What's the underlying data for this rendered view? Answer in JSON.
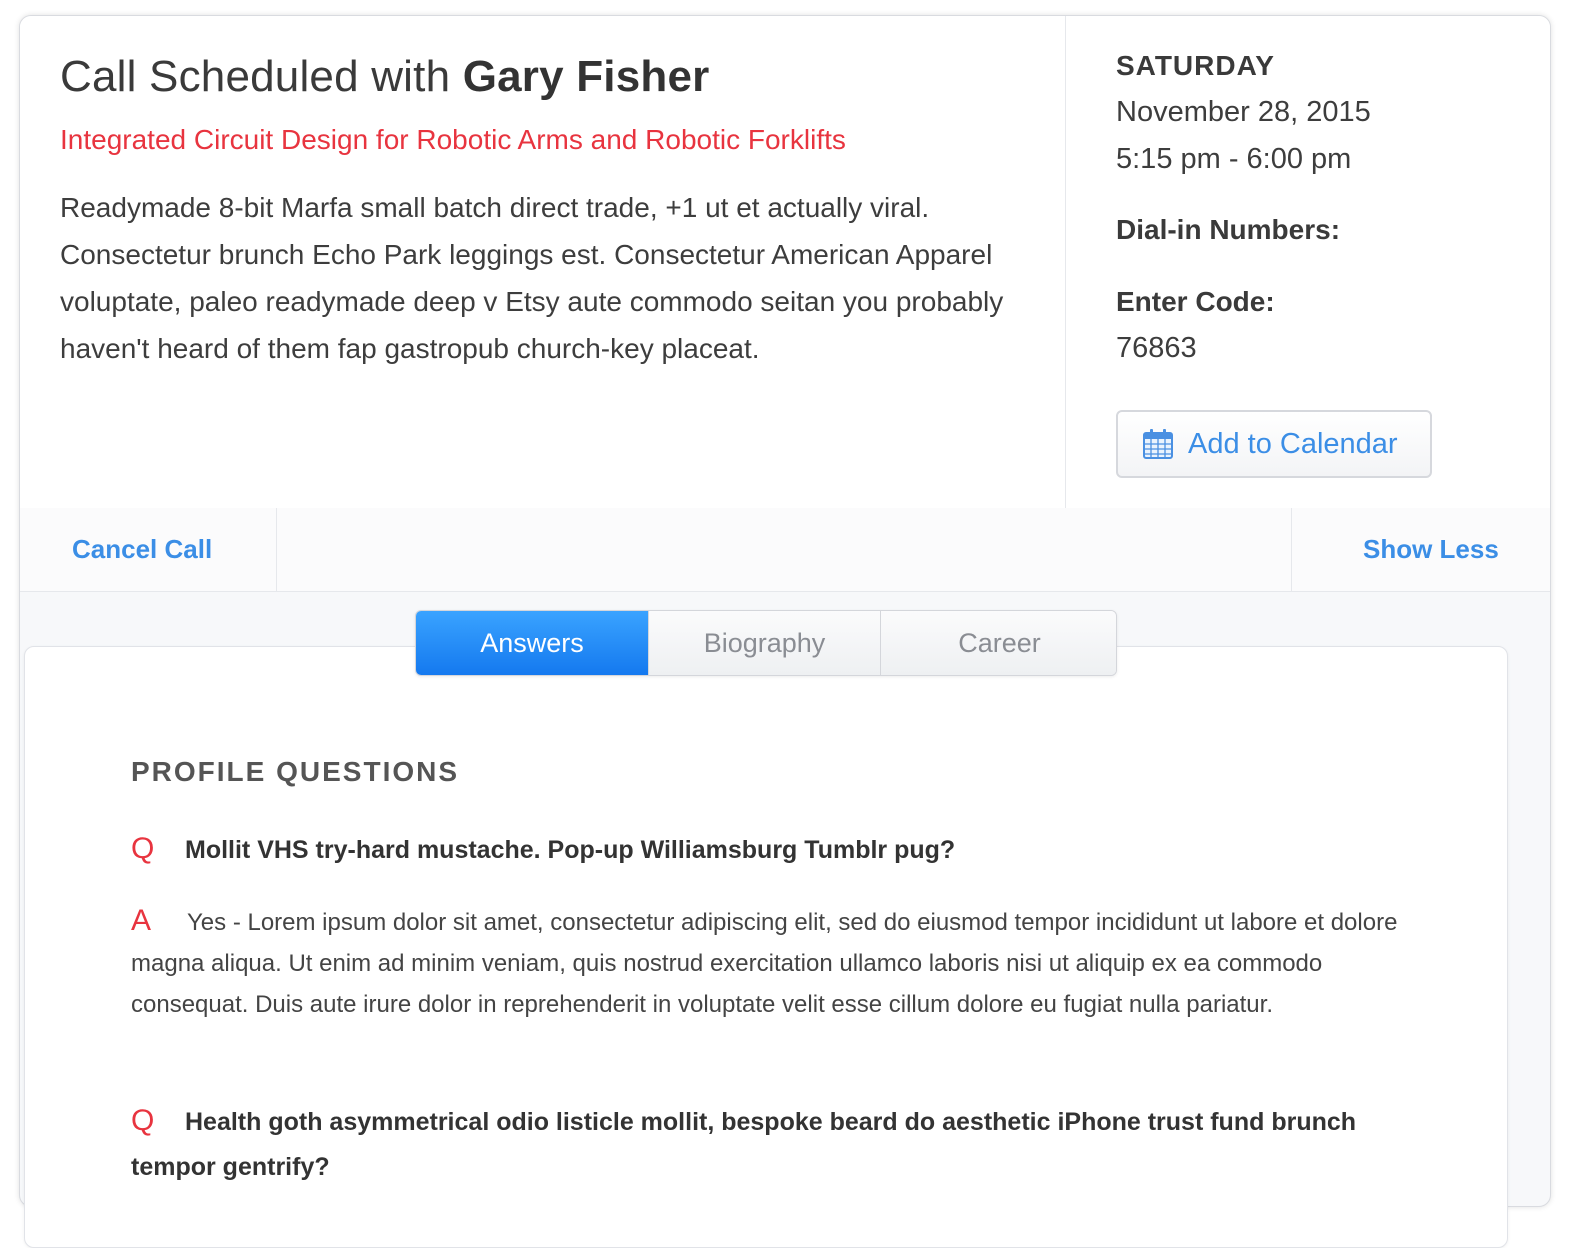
{
  "call": {
    "title_prefix": "Call Scheduled with",
    "expert_name": "Gary Fisher",
    "project": "Integrated Circuit Design for Robotic Arms and Robotic Forklifts",
    "description": "Readymade 8-bit Marfa small batch direct trade, +1 ut et actually viral. Consectetur brunch Echo Park leggings est. Consectetur American Apparel voluptate, paleo readymade deep v Etsy aute commodo seitan you probably haven't heard of them fap gastropub church-key placeat."
  },
  "schedule": {
    "day": "SATURDAY",
    "date": "November 28, 2015",
    "time": "5:15 pm - 6:00 pm",
    "dial_in_label": "Dial-in Numbers:",
    "code_label": "Enter Code:",
    "code_value": "76863",
    "add_calendar_label": "Add to Calendar",
    "calendar_icon": "calendar-icon"
  },
  "actions": {
    "cancel_label": "Cancel Call",
    "show_less_label": "Show Less"
  },
  "tabs": [
    {
      "label": "Answers",
      "active": true
    },
    {
      "label": "Biography",
      "active": false
    },
    {
      "label": "Career",
      "active": false
    }
  ],
  "profile": {
    "section_title": "PROFILE QUESTIONS",
    "q_marker": "Q",
    "a_marker": "A",
    "items": [
      {
        "question": "Mollit VHS try-hard mustache. Pop-up Williamsburg Tumblr pug?",
        "answer": "Yes - Lorem ipsum dolor sit amet, consectetur adipiscing elit, sed do eiusmod tempor incididunt ut labore et dolore magna aliqua. Ut enim ad minim veniam, quis nostrud exercitation ullamco laboris nisi ut aliquip ex ea commodo consequat. Duis aute irure dolor in reprehenderit in voluptate velit esse cillum dolore eu fugiat nulla pariatur."
      },
      {
        "question": "Health goth asymmetrical odio listicle mollit, bespoke beard do aesthetic iPhone trust fund brunch tempor gentrify?",
        "answer": ""
      }
    ]
  },
  "colors": {
    "accent_blue": "#3b8ee6",
    "tab_active": "#1479ef",
    "accent_red": "#e8343f"
  }
}
